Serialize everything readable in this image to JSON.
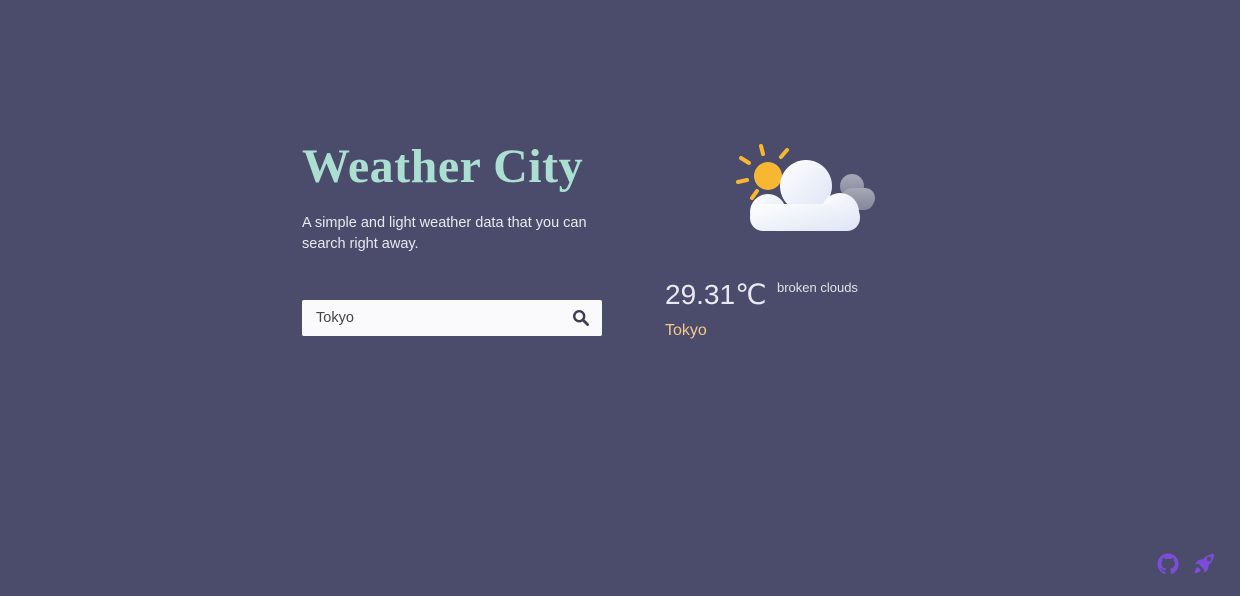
{
  "app": {
    "title": "Weather City",
    "subtitle": "A simple and light weather data that you can search right away."
  },
  "search": {
    "value": "Tokyo",
    "placeholder": "",
    "button_icon": "search-icon"
  },
  "weather": {
    "icon": "partly-cloudy-icon",
    "temperature": "29.31",
    "unit": "℃",
    "description": "broken clouds",
    "city": "Tokyo"
  },
  "footer": {
    "icons": [
      "github-icon",
      "rocket-icon"
    ],
    "icon_color": "#7c4ddb"
  },
  "colors": {
    "background": "#4b4b6b",
    "title": "#aadfd2",
    "city": "#f3c98b",
    "sun": "#f7b733"
  }
}
